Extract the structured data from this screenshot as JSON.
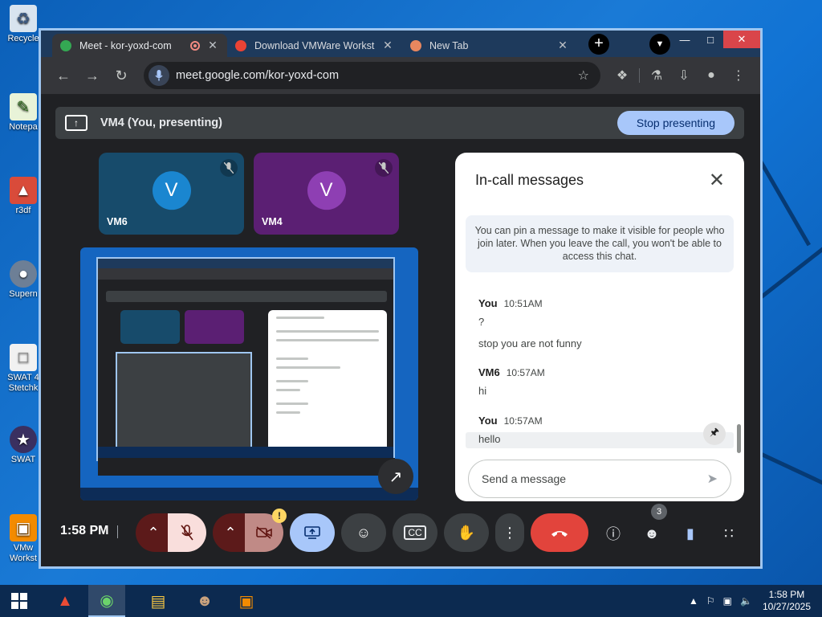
{
  "desktop": {
    "icons": [
      {
        "label": "Recycle",
        "icon": "recycle-bin-icon"
      },
      {
        "label": "Notepa",
        "icon": "notepad-icon"
      },
      {
        "label": "r3df",
        "icon": "app-icon"
      },
      {
        "label": "Supern",
        "icon": "app-icon"
      },
      {
        "label": "SWAT 4\nStetchk",
        "icon": "document-icon"
      },
      {
        "label": "SWAT",
        "icon": "app-icon"
      },
      {
        "label": "VMw\nWorkst",
        "icon": "vmware-icon"
      }
    ]
  },
  "browser": {
    "tabs": [
      {
        "title": "Meet - kor-yoxd-com",
        "active": true,
        "favicon_color": "#34a853",
        "recording": true
      },
      {
        "title": "Download VMWare Workst",
        "active": false,
        "favicon_color": "#ea4335"
      },
      {
        "title": "New Tab",
        "active": false,
        "favicon_color": "#e8875f"
      }
    ],
    "url": "meet.google.com/kor-yoxd-com"
  },
  "meet": {
    "presenting_text": "VM4 (You, presenting)",
    "stop_presenting_label": "Stop presenting",
    "tiles": [
      {
        "name": "VM6",
        "initial": "V",
        "bg": "#174b6b",
        "avatar_bg": "#1a86d0"
      },
      {
        "name": "VM4",
        "initial": "V",
        "bg": "#5b1f73",
        "avatar_bg": "#8e3fb3"
      }
    ],
    "chat": {
      "title": "In-call messages",
      "info": "You can pin a message to make it visible for people who join later. When you leave the call, you won't be able to access this chat.",
      "messages": [
        {
          "sender": "You",
          "time": "10:51AM",
          "lines": [
            "?",
            "stop you are not funny"
          ]
        },
        {
          "sender": "VM6",
          "time": "10:57AM",
          "lines": [
            "hi"
          ]
        },
        {
          "sender": "You",
          "time": "10:57AM",
          "lines": [
            "hello"
          ]
        }
      ],
      "input_placeholder": "Send a message"
    },
    "clock": "1:58 PM",
    "people_count": "3",
    "camera_warning": "!"
  },
  "taskbar": {
    "time": "1:58 PM",
    "date": "10/27/2025"
  },
  "colors": {
    "end_call": "#e2443c",
    "present_active": "#a8c7fa",
    "muted_btn": "#f9dedc"
  }
}
